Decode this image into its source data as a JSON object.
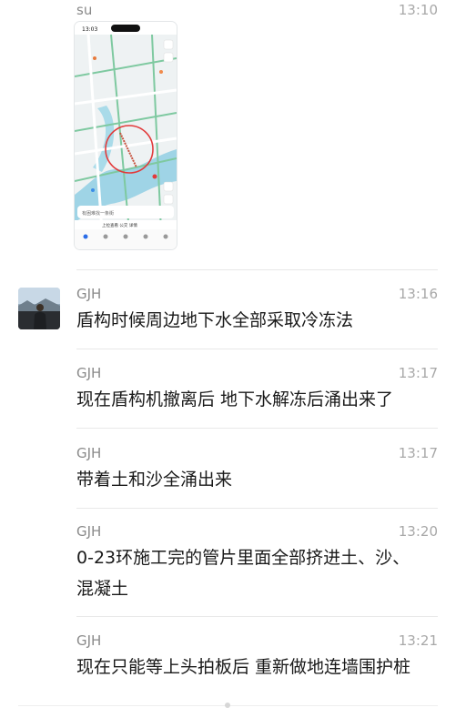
{
  "messages": [
    {
      "sender": "su",
      "time": "13:10",
      "type": "image",
      "image": {
        "status_time": "13:03",
        "search_placeholder": "有困难找一条街",
        "bottom_banner": "上拉查看 公交 详情"
      }
    },
    {
      "sender": "GJH",
      "time": "13:16",
      "text": "盾构时候周边地下水全部采取冷冻法",
      "avatar": "person-photo"
    },
    {
      "sender": "GJH",
      "time": "13:17",
      "text": "现在盾构机撤离后 地下水解冻后涌出来了"
    },
    {
      "sender": "GJH",
      "time": "13:17",
      "text": "带着土和沙全涌出来"
    },
    {
      "sender": "GJH",
      "time": "13:20",
      "text_line1": "0-23环施工完的管片里面全部挤进土、沙、",
      "text_line2": "混凝土"
    },
    {
      "sender": "GJH",
      "time": "13:21",
      "text": "现在只能等上头拍板后 重新做地连墙围护桩"
    }
  ],
  "colors": {
    "name": "#8a8a8a",
    "time": "#a8a8a8",
    "text": "#1a1a1a",
    "map_circle": "#e23a3a"
  }
}
